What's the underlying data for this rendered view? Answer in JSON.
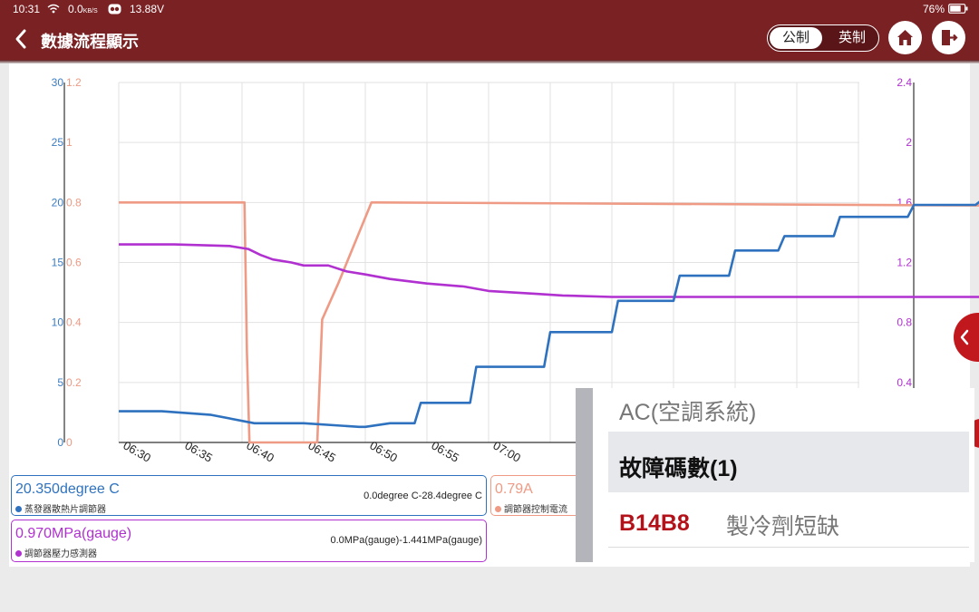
{
  "status_bar": {
    "time": "10:31",
    "net_speed": "0.0",
    "net_unit": "KB/S",
    "voltage": "13.88V",
    "battery": "76%"
  },
  "header": {
    "title": "數據流程顯示",
    "unit_metric": "公制",
    "unit_imperial": "英制",
    "home_icon": "home-icon",
    "exit_icon": "exit-icon"
  },
  "colors": {
    "header": "#7a2124",
    "temperature": "#2e72bf",
    "current": "#ee9a84",
    "pressure": "#b030d0",
    "fault_code": "#b3121a"
  },
  "chart_data": {
    "type": "line",
    "x_ticks": [
      "06:30",
      "06:35",
      "06:40",
      "06:45",
      "06:50",
      "06:55",
      "07:00"
    ],
    "y_left_ticks": [
      "30",
      "25",
      "20",
      "15",
      "10",
      "5",
      "0"
    ],
    "y_left2_ticks": [
      "1.2",
      "1",
      "0.8",
      "0.6",
      "0.4",
      "0.2",
      "0"
    ],
    "y_right_ticks": [
      "2.4",
      "2",
      "1.6",
      "1.2",
      "0.8",
      "0.4"
    ],
    "grid": true,
    "series": [
      {
        "name": "蒸發器散熱片調節器",
        "axis": "left",
        "ylim": [
          0,
          30
        ],
        "x": [
          0,
          3.5,
          7.5,
          11,
          15,
          19.5,
          20,
          22,
          24,
          24.5,
          28.5,
          29,
          34.5,
          35,
          40,
          40.5,
          45,
          45.5,
          49.5,
          50,
          53.5,
          54,
          58,
          58.5,
          64,
          64.5,
          69.5,
          70
        ],
        "y": [
          2.6,
          2.6,
          2.3,
          1.6,
          1.6,
          1.3,
          1.3,
          1.6,
          1.6,
          3.3,
          3.3,
          6.3,
          6.3,
          9.2,
          9.2,
          11.8,
          11.8,
          13.9,
          13.9,
          16.0,
          16.0,
          17.2,
          17.2,
          18.8,
          18.8,
          19.8,
          19.8,
          20.2
        ]
      },
      {
        "name": "調節器控制電流",
        "axis": "left2",
        "ylim": [
          0,
          1.2
        ],
        "x": [
          0,
          10.2,
          10.4,
          10.6,
          15.8,
          16.1,
          16.5,
          17.8,
          19,
          20.5,
          21,
          70
        ],
        "y": [
          0.8,
          0.8,
          0.3,
          0.0,
          0.0,
          0.0,
          0.41,
          0.53,
          0.65,
          0.8,
          0.8,
          0.79
        ]
      },
      {
        "name": "調節器壓力感測器",
        "axis": "right",
        "ylim": [
          0,
          2.4
        ],
        "x": [
          0,
          4.5,
          9,
          10.5,
          11.5,
          12.5,
          14,
          15,
          17,
          18.5,
          20,
          22,
          25,
          28,
          30,
          34,
          36,
          40,
          44,
          47,
          55,
          60,
          65,
          70
        ],
        "y": [
          1.32,
          1.32,
          1.31,
          1.29,
          1.25,
          1.22,
          1.2,
          1.18,
          1.18,
          1.14,
          1.12,
          1.09,
          1.06,
          1.04,
          1.01,
          0.99,
          0.98,
          0.97,
          0.97,
          0.97,
          0.97,
          0.97,
          0.97,
          0.97
        ]
      }
    ]
  },
  "cards": {
    "temperature": {
      "value": "20.350degree C",
      "label": "蒸發器散熱片調節器",
      "range": "0.0degree C-28.4degree C"
    },
    "current": {
      "value": "0.79A",
      "label": "調節器控制電流"
    },
    "pressure": {
      "value": "0.970MPa(gauge)",
      "label": "調節器壓力感測器",
      "range": "0.0MPa(gauge)-1.441MPa(gauge)"
    }
  },
  "fault_popup": {
    "system": "AC(空調系統)",
    "count_label": "故障碼數(1)",
    "code": "B14B8",
    "description": "製冷劑短缺"
  }
}
